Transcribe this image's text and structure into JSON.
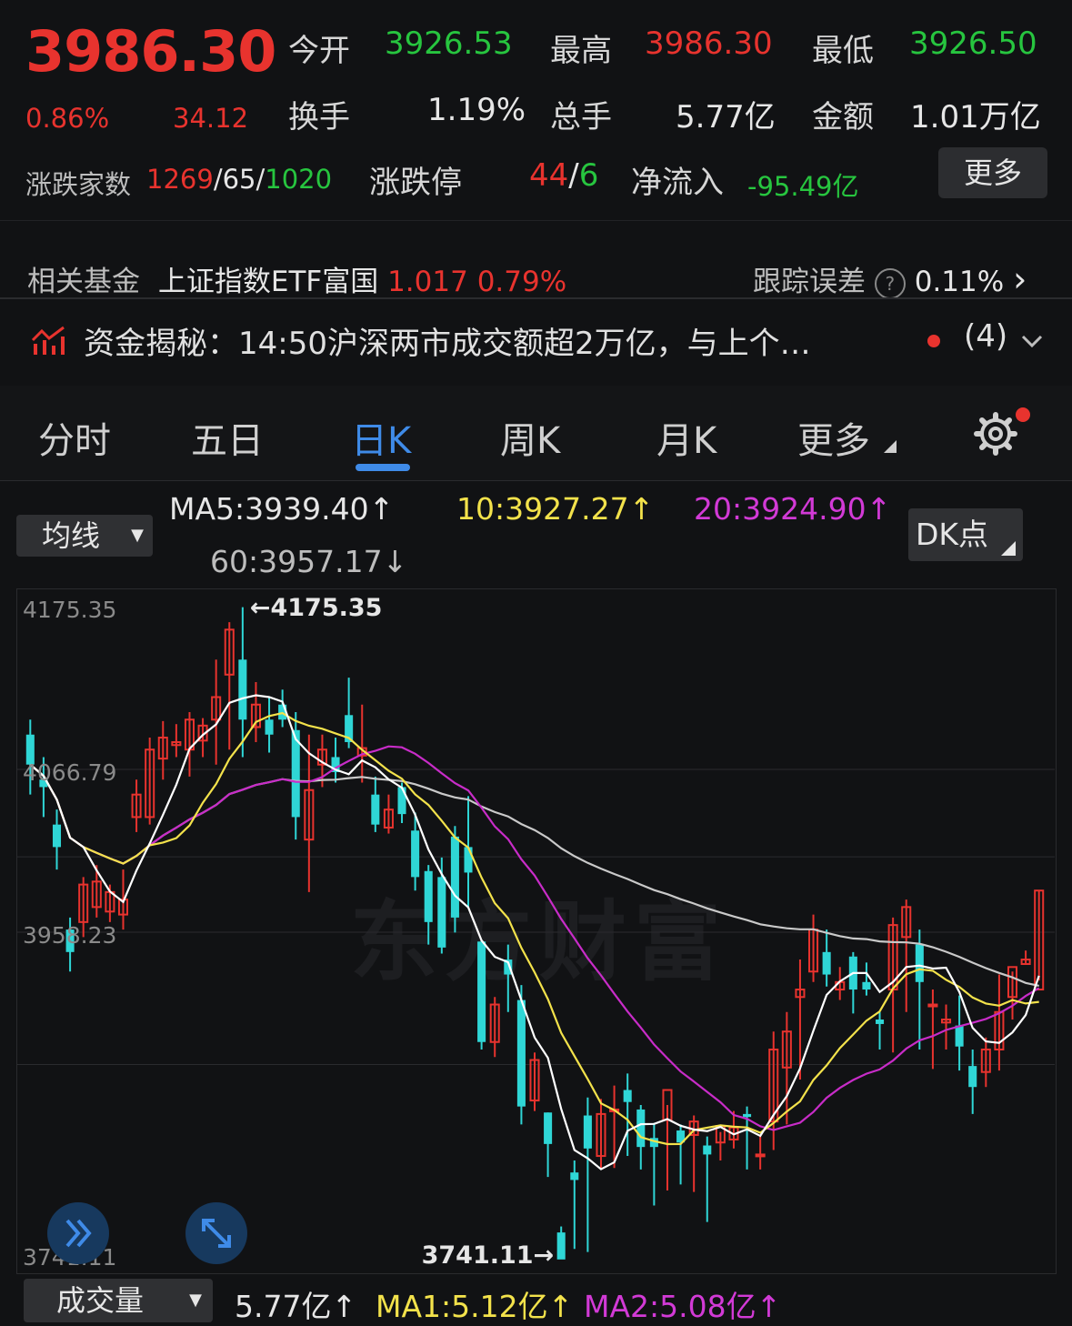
{
  "header": {
    "price": "3986.30",
    "change_pct": "0.86%",
    "change": "34.12",
    "open_label": "今开",
    "open": "3926.53",
    "high_label": "最高",
    "high": "3986.30",
    "low_label": "最低",
    "low": "3926.50",
    "turnover_label": "换手",
    "turnover": "1.19%",
    "volume_label": "总手",
    "volume": "5.77亿",
    "amount_label": "金额",
    "amount": "1.01万亿",
    "breadth_label": "涨跌家数",
    "up_count": "1269",
    "flat_count": "65",
    "down_count": "1020",
    "limit_label": "涨跌停",
    "limit_up": "44",
    "limit_down": "6",
    "inflow_label": "净流入",
    "inflow": "-95.49亿",
    "more_label": "更多"
  },
  "fund": {
    "label": "相关基金",
    "name": "上证指数ETF富国",
    "price": "1.017",
    "pct": "0.79%",
    "tracking_label": "跟踪误差",
    "tracking_help": "?",
    "tracking_value": "0.11%",
    "chevron": "›"
  },
  "news": {
    "text": "资金揭秘：14:50沪深两市成交额超2万亿，与上个…",
    "count": "(4)"
  },
  "tabs": [
    {
      "label": "分时"
    },
    {
      "label": "五日"
    },
    {
      "label": "日K"
    },
    {
      "label": "周K"
    },
    {
      "label": "月K"
    },
    {
      "label": "更多"
    }
  ],
  "ma_bar": {
    "dropdown_label": "均线",
    "ma5": "MA5:3939.40↑",
    "ma10": "10:3927.27↑",
    "ma20": "20:3924.90↑",
    "ma60": "60:3957.17↓",
    "dk_label": "DK点"
  },
  "chart_data": {
    "type": "candlestick",
    "y_axis_labels": [
      "4175.35",
      "4066.79",
      "3958.23",
      "3741.11"
    ],
    "ylim": [
      3741.11,
      4175.35
    ],
    "max_annotation": "←4175.35",
    "min_annotation": "3741.11→",
    "watermark": "东方财富",
    "colors": {
      "up": "#e8332e",
      "down": "#2fd6d6",
      "ma5": "#ffffff",
      "ma10": "#f3e24b",
      "ma20": "#c82cc8",
      "ma60": "#c9c9c9"
    },
    "candles": [
      [
        4090,
        4070,
        4100,
        4050
      ],
      [
        4060,
        4055,
        4075,
        4035
      ],
      [
        4030,
        4015,
        4040,
        4000
      ],
      [
        3960,
        3945,
        3968,
        3932
      ],
      [
        3965,
        3990,
        3995,
        3955
      ],
      [
        3975,
        3992,
        4003,
        3968
      ],
      [
        3972,
        3985,
        3990,
        3965
      ],
      [
        3970,
        3980,
        4000,
        3960
      ],
      [
        4035,
        4050,
        4060,
        4025
      ],
      [
        4035,
        4080,
        4088,
        4030
      ],
      [
        4074,
        4088,
        4099,
        4060
      ],
      [
        4083,
        4085,
        4097,
        4075
      ],
      [
        4080,
        4100,
        4105,
        4062
      ],
      [
        4086,
        4096,
        4101,
        4075
      ],
      [
        4100,
        4115,
        4140,
        4070
      ],
      [
        4130,
        4160,
        4165,
        4080
      ],
      [
        4140,
        4100,
        4175,
        4075
      ],
      [
        4095,
        4110,
        4125,
        4085
      ],
      [
        4100,
        4090,
        4115,
        4078
      ],
      [
        4110,
        4100,
        4120,
        4095
      ],
      [
        4093,
        4035,
        4105,
        4020
      ],
      [
        4020,
        4053,
        4090,
        3985
      ],
      [
        4070,
        4080,
        4090,
        4055
      ],
      [
        4075,
        4065,
        4088,
        4058
      ],
      [
        4103,
        4085,
        4128,
        4081
      ],
      [
        4076,
        4081,
        4110,
        4058
      ],
      [
        4050,
        4030,
        4062,
        4025
      ],
      [
        4028,
        4040,
        4050,
        4024
      ],
      [
        4055,
        4037,
        4058,
        4031
      ],
      [
        4026,
        3995,
        4038,
        3986
      ],
      [
        3999,
        3965,
        4003,
        3950
      ],
      [
        3995,
        3948,
        4008,
        3944
      ],
      [
        4022,
        3968,
        4029,
        3958
      ],
      [
        4015,
        3998,
        4049,
        3975
      ],
      [
        3952,
        3885,
        3953,
        3880
      ],
      [
        3885,
        3910,
        3915,
        3875
      ],
      [
        3940,
        3930,
        3950,
        3905
      ],
      [
        3913,
        3842,
        3923,
        3830
      ],
      [
        3846,
        3873,
        3878,
        3839
      ],
      [
        3838,
        3817,
        3838,
        3795
      ],
      [
        3758,
        3740,
        3762,
        3741
      ],
      [
        3798,
        3793,
        3806,
        3747
      ],
      [
        3836,
        3814,
        3848,
        3745
      ],
      [
        3809,
        3837,
        3847,
        3800
      ],
      [
        3840,
        3840,
        3856,
        3801
      ],
      [
        3853,
        3845,
        3864,
        3809
      ],
      [
        3840,
        3815,
        3843,
        3800
      ],
      [
        3821,
        3815,
        3831,
        3776
      ],
      [
        3833,
        3853,
        3843,
        3786
      ],
      [
        3826,
        3818,
        3830,
        3790
      ],
      [
        3823,
        3832,
        3836,
        3785
      ],
      [
        3816,
        3810,
        3822,
        3765
      ],
      [
        3818,
        3829,
        3825,
        3806
      ],
      [
        3820,
        3828,
        3839,
        3814
      ],
      [
        3837,
        3835,
        3842,
        3800
      ],
      [
        3810,
        3810,
        3822,
        3800
      ],
      [
        3832,
        3880,
        3892,
        3813
      ],
      [
        3868,
        3892,
        3905,
        3830
      ],
      [
        3915,
        3920,
        3940,
        3860
      ],
      [
        3932,
        3960,
        3970,
        3925
      ],
      [
        3945,
        3930,
        3960,
        3922
      ],
      [
        3920,
        3925,
        3935,
        3913
      ],
      [
        3942,
        3920,
        3945,
        3904
      ],
      [
        3925,
        3920,
        3938,
        3916
      ],
      [
        3900,
        3897,
        3905,
        3880
      ],
      [
        3920,
        3963,
        3968,
        3878
      ],
      [
        3955,
        3975,
        3980,
        3905
      ],
      [
        3950,
        3925,
        3960,
        3880
      ],
      [
        3910,
        3910,
        3920,
        3867
      ],
      [
        3898,
        3900,
        3910,
        3880
      ],
      [
        3896,
        3882,
        3916,
        3866
      ],
      [
        3869,
        3855,
        3880,
        3837
      ],
      [
        3865,
        3880,
        3888,
        3855
      ],
      [
        3880,
        3905,
        3930,
        3866
      ],
      [
        3915,
        3935,
        3932,
        3900
      ],
      [
        3937,
        3940,
        3946,
        3937
      ],
      [
        3920,
        3986,
        3986,
        3926
      ]
    ]
  },
  "volume_bar": {
    "dropdown_label": "成交量",
    "vol": "5.77亿↑",
    "ma1": "MA1:5.12亿↑",
    "ma2": "MA2:5.08亿↑"
  }
}
